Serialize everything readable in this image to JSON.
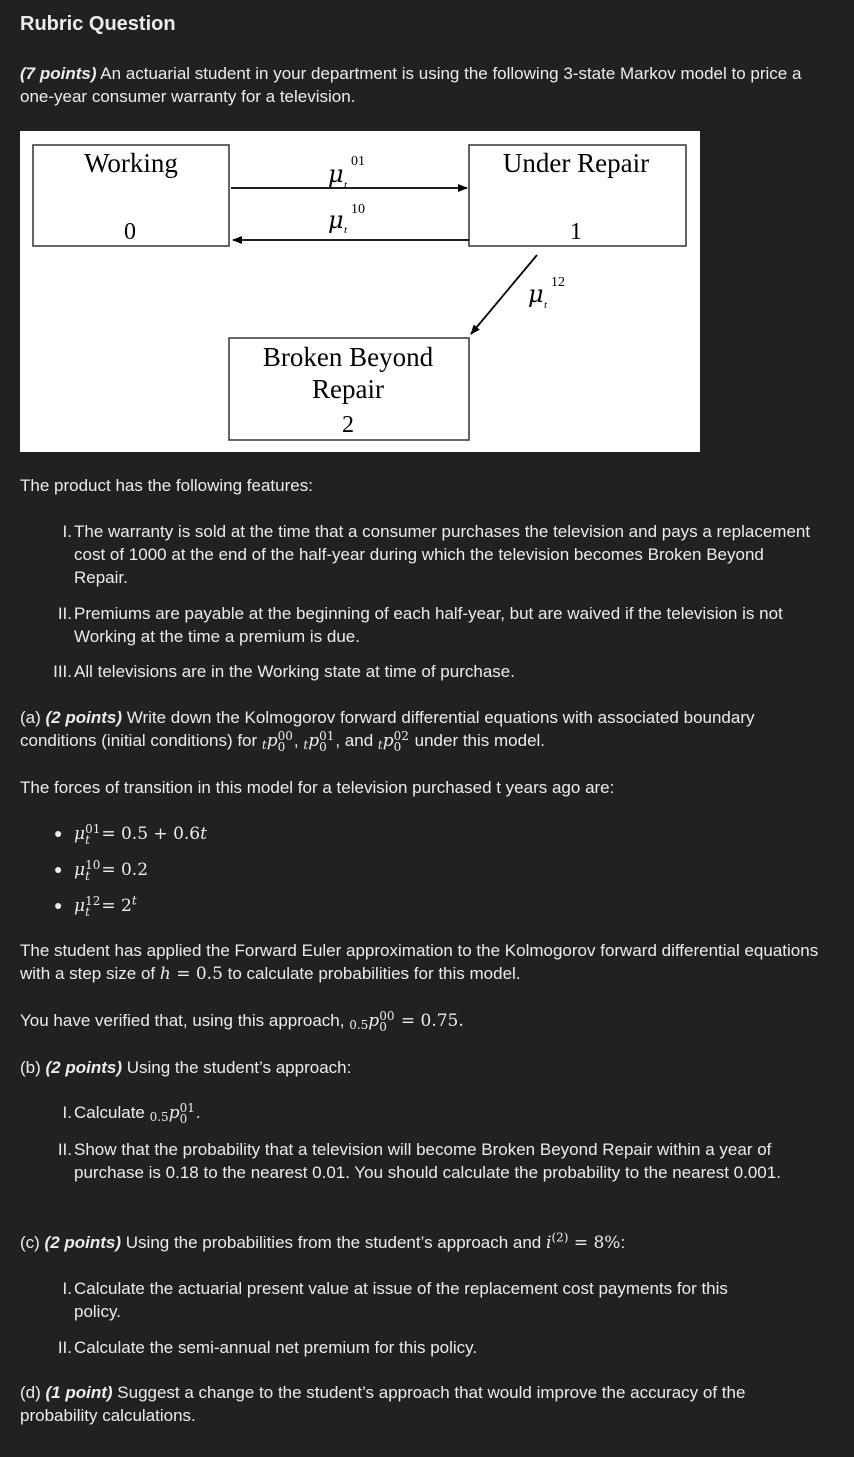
{
  "header": {
    "title": "Rubric Question"
  },
  "intro": {
    "points": "(7 points)",
    "text": " An actuarial student in your department is using the following 3-state Markov model to price a one-year consumer warranty for a television."
  },
  "diagram": {
    "state0": {
      "name": "Working",
      "number": "0"
    },
    "state1": {
      "name": "Under Repair",
      "number": "1"
    },
    "state2": {
      "name_line1": "Broken Beyond",
      "name_line2": "Repair",
      "number": "2"
    },
    "mu_symbol": "μ",
    "mu_sub": "t",
    "t01": "01",
    "t10": "10",
    "t12": "12"
  },
  "features": {
    "heading": "The product has the following features:",
    "items": [
      {
        "numeral": "I.",
        "text": "The warranty is sold at the time that a consumer purchases the television and pays a replacement cost of 1000 at the end of the half-year during which the television becomes Broken Beyond Repair."
      },
      {
        "numeral": "II.",
        "text": "Premiums are payable at the beginning of each half-year, but are waived if the television is not Working at the time a premium is due."
      },
      {
        "numeral": "III.",
        "text": "All televisions are in the Working state at time of purchase."
      }
    ]
  },
  "part_a": {
    "label": "(a) ",
    "points": "(2 points)",
    "text": " Write down the Kolmogorov forward differential equations with associated boundary conditions (initial conditions) for ",
    "comma": ", ",
    "and_text": ", and ",
    "tail": " under this model."
  },
  "forces": {
    "heading": "The forces of transition in this model for a television purchased t years ago are:",
    "items": [
      {
        "sup": "01",
        "rhs": "= 0.5 + 0.6",
        "var": "t"
      },
      {
        "sup": "10",
        "rhs": "= 0.2",
        "var": ""
      },
      {
        "sup": "12",
        "rhs": "= 2",
        "var": "",
        "exp": "t"
      }
    ]
  },
  "euler": {
    "text": "The student has applied the Forward Euler approximation to the Kolmogorov forward differential equations with a step size of ",
    "h": "h",
    "h_val": " = 0.5",
    "tail": " to calculate probabilities for this model."
  },
  "verified": {
    "text": "You have verified that, using this approach, ",
    "pre": "0.5",
    "sup": "00",
    "value": " = 0.75."
  },
  "part_b": {
    "label": "(b) ",
    "points": "(2 points)",
    "text": " Using the student’s approach:",
    "items": [
      {
        "numeral": "I.",
        "text": "Calculate ",
        "pre": "0.5",
        "sup": "01",
        "tail": "."
      },
      {
        "numeral": "II.",
        "text": "Show that the probability that a television will become Broken Beyond Repair within a year of purchase is 0.18 to the nearest 0.01. You should calculate the probability to the nearest 0.001."
      }
    ]
  },
  "part_c": {
    "label": "(c) ",
    "points": "(2 points)",
    "text": " Using the probabilities from the student’s approach and ",
    "i_sym": "i",
    "i_sup": "(2)",
    "i_val": " = 8%",
    "tail": ":",
    "items": [
      {
        "numeral": "I.",
        "text": "Calculate the actuarial present value at issue of the replacement cost payments for this policy."
      },
      {
        "numeral": "II.",
        "text": "Calculate the semi-annual net premium for this policy."
      }
    ]
  },
  "part_d": {
    "label": "(d) ",
    "points": "(1 point)",
    "text": " Suggest a change to the student’s approach that would improve the accuracy of the probability calculations."
  },
  "math": {
    "p": "p",
    "sub0": "0",
    "t": "t",
    "mu": "μ",
    "sub_t": "t",
    "sup00": "00",
    "sup01": "01",
    "sup02": "02"
  }
}
